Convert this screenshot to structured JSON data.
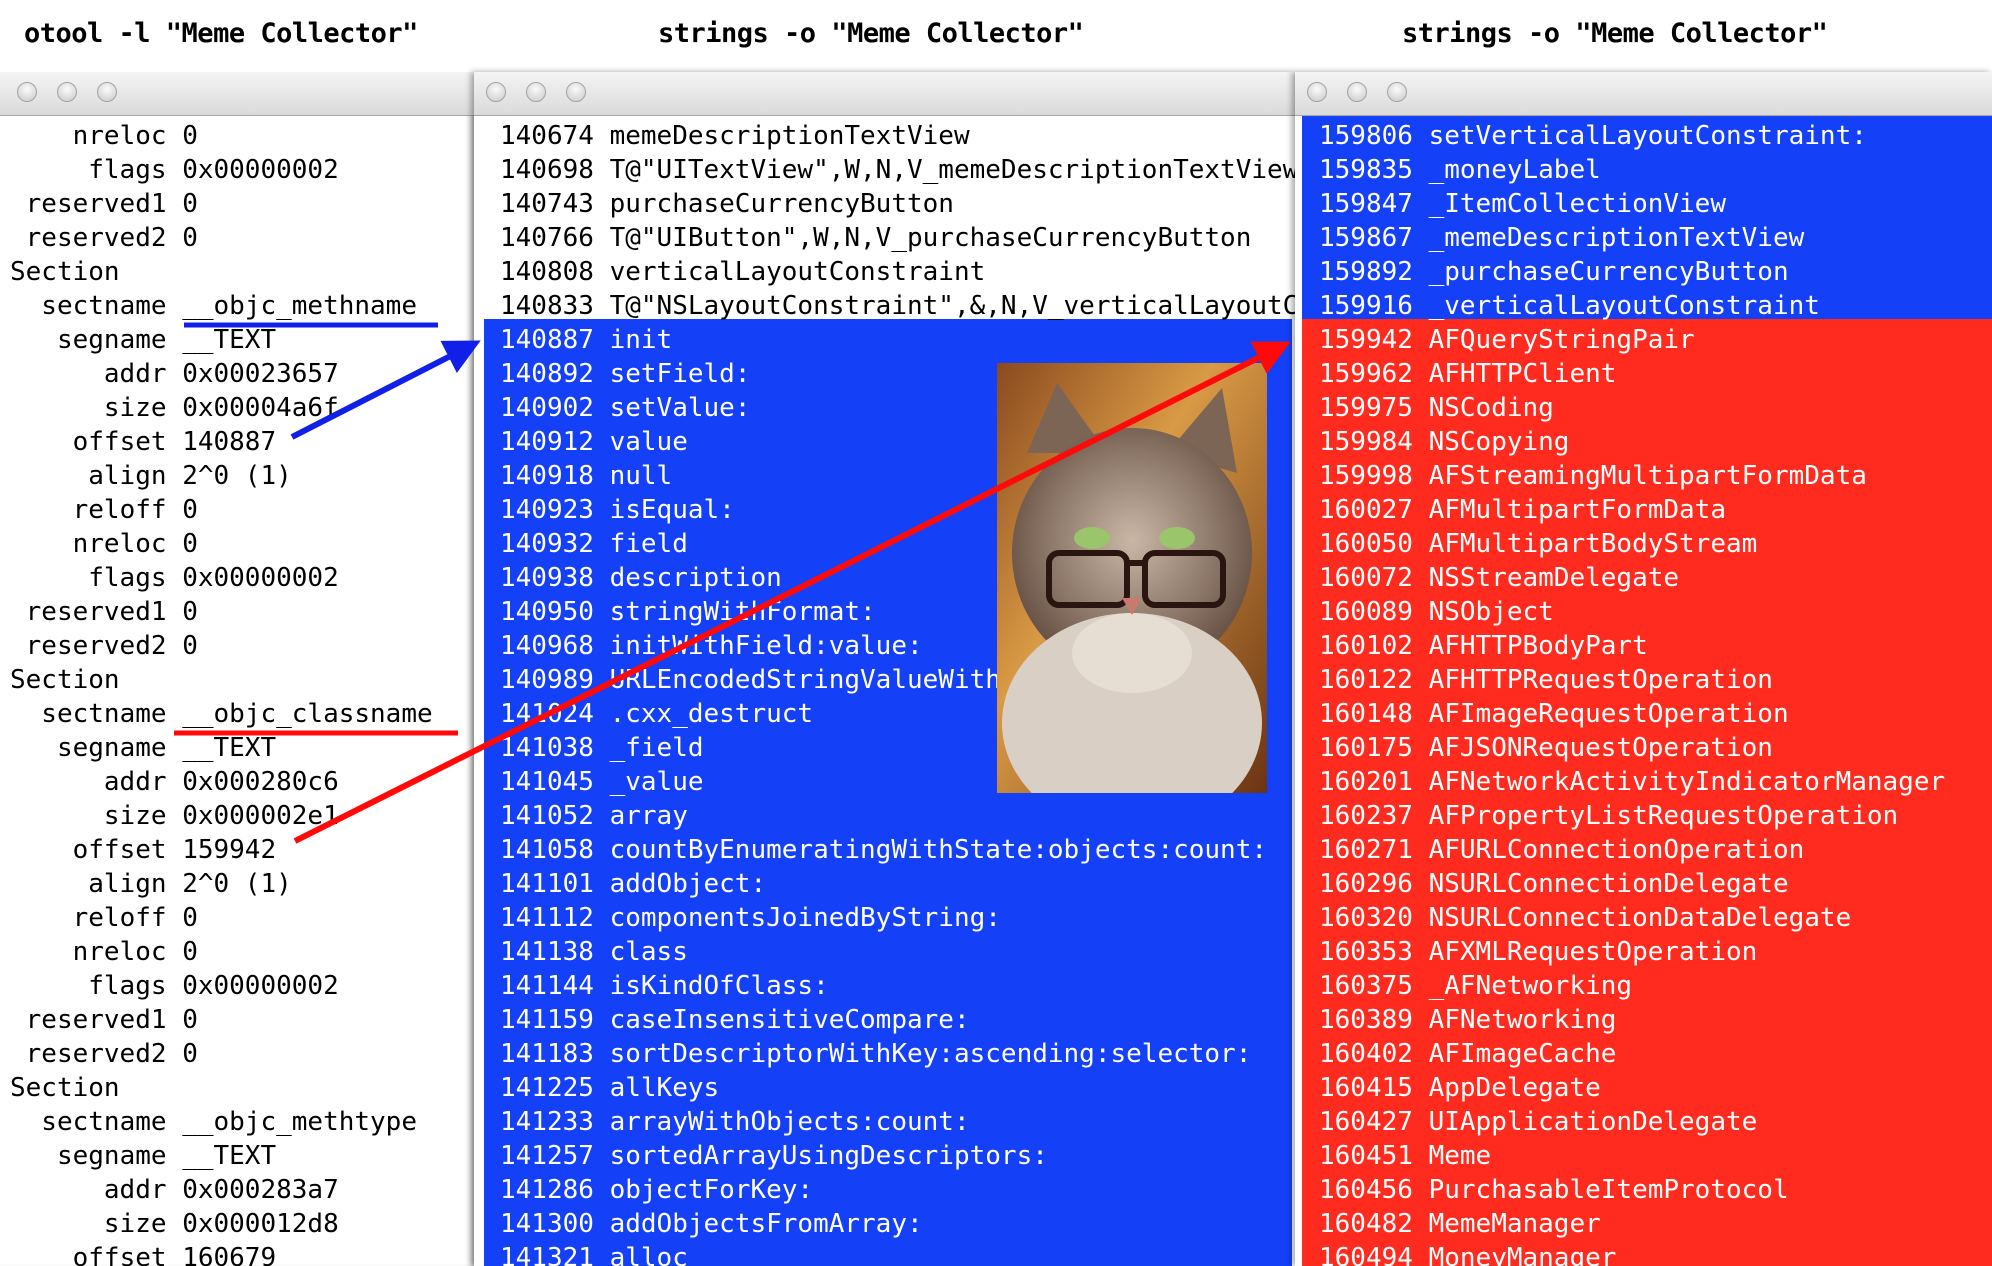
{
  "titles": {
    "left": "otool -l \"Meme Collector\"",
    "middle": "strings -o \"Meme Collector\"",
    "right": "strings -o \"Meme Collector\""
  },
  "colors": {
    "highlight_blue": "#1440f8",
    "highlight_red": "#ff2b1f"
  },
  "left": {
    "rows": [
      {
        "label": "nreloc",
        "value": "0"
      },
      {
        "label": "flags",
        "value": "0x00000002"
      },
      {
        "label": "reserved1",
        "value": "0"
      },
      {
        "label": "reserved2",
        "value": "0"
      },
      {
        "label": "Section"
      },
      {
        "label": "sectname",
        "value": "__objc_methname"
      },
      {
        "label": "segname",
        "value": "__TEXT"
      },
      {
        "label": "addr",
        "value": "0x00023657"
      },
      {
        "label": "size",
        "value": "0x00004a6f"
      },
      {
        "label": "offset",
        "value": "140887"
      },
      {
        "label": "align",
        "value": "2^0 (1)"
      },
      {
        "label": "reloff",
        "value": "0"
      },
      {
        "label": "nreloc",
        "value": "0"
      },
      {
        "label": "flags",
        "value": "0x00000002"
      },
      {
        "label": "reserved1",
        "value": "0"
      },
      {
        "label": "reserved2",
        "value": "0"
      },
      {
        "label": "Section"
      },
      {
        "label": "sectname",
        "value": "__objc_classname"
      },
      {
        "label": "segname",
        "value": "__TEXT"
      },
      {
        "label": "addr",
        "value": "0x000280c6"
      },
      {
        "label": "size",
        "value": "0x000002e1"
      },
      {
        "label": "offset",
        "value": "159942"
      },
      {
        "label": "align",
        "value": "2^0 (1)"
      },
      {
        "label": "reloff",
        "value": "0"
      },
      {
        "label": "nreloc",
        "value": "0"
      },
      {
        "label": "flags",
        "value": "0x00000002"
      },
      {
        "label": "reserved1",
        "value": "0"
      },
      {
        "label": "reserved2",
        "value": "0"
      },
      {
        "label": "Section"
      },
      {
        "label": "sectname",
        "value": "__objc_methtype"
      },
      {
        "label": "segname",
        "value": "__TEXT"
      },
      {
        "label": "addr",
        "value": "0x000283a7"
      },
      {
        "label": "size",
        "value": "0x000012d8"
      },
      {
        "label": "offset",
        "value": "160679"
      }
    ]
  },
  "middle": {
    "highlight_from_offset": "140887",
    "rows": [
      {
        "offset": "140674",
        "name": "memeDescriptionTextView"
      },
      {
        "offset": "140698",
        "name": "T@\"UITextView\",W,N,V_memeDescriptionTextView"
      },
      {
        "offset": "140743",
        "name": "purchaseCurrencyButton"
      },
      {
        "offset": "140766",
        "name": "T@\"UIButton\",W,N,V_purchaseCurrencyButton"
      },
      {
        "offset": "140808",
        "name": "verticalLayoutConstraint"
      },
      {
        "offset": "140833",
        "name": "T@\"NSLayoutConstraint\",&,N,V_verticalLayoutConstraint"
      },
      {
        "offset": "140887",
        "name": "init"
      },
      {
        "offset": "140892",
        "name": "setField:"
      },
      {
        "offset": "140902",
        "name": "setValue:"
      },
      {
        "offset": "140912",
        "name": "value"
      },
      {
        "offset": "140918",
        "name": "null"
      },
      {
        "offset": "140923",
        "name": "isEqual:"
      },
      {
        "offset": "140932",
        "name": "field"
      },
      {
        "offset": "140938",
        "name": "description"
      },
      {
        "offset": "140950",
        "name": "stringWithFormat:"
      },
      {
        "offset": "140968",
        "name": "initWithField:value:"
      },
      {
        "offset": "140989",
        "name": "URLEncodedStringValueWithEncoding:"
      },
      {
        "offset": "141024",
        "name": ".cxx_destruct"
      },
      {
        "offset": "141038",
        "name": "_field"
      },
      {
        "offset": "141045",
        "name": "_value"
      },
      {
        "offset": "141052",
        "name": "array"
      },
      {
        "offset": "141058",
        "name": "countByEnumeratingWithState:objects:count:"
      },
      {
        "offset": "141101",
        "name": "addObject:"
      },
      {
        "offset": "141112",
        "name": "componentsJoinedByString:"
      },
      {
        "offset": "141138",
        "name": "class"
      },
      {
        "offset": "141144",
        "name": "isKindOfClass:"
      },
      {
        "offset": "141159",
        "name": "caseInsensitiveCompare:"
      },
      {
        "offset": "141183",
        "name": "sortDescriptorWithKey:ascending:selector:"
      },
      {
        "offset": "141225",
        "name": "allKeys"
      },
      {
        "offset": "141233",
        "name": "arrayWithObjects:count:"
      },
      {
        "offset": "141257",
        "name": "sortedArrayUsingDescriptors:"
      },
      {
        "offset": "141286",
        "name": "objectForKey:"
      },
      {
        "offset": "141300",
        "name": "addObjectsFromArray:"
      },
      {
        "offset": "141321",
        "name": "alloc"
      }
    ]
  },
  "right": {
    "red_from_offset": "159942",
    "rows": [
      {
        "offset": "159806",
        "name": "setVerticalLayoutConstraint:"
      },
      {
        "offset": "159835",
        "name": "_moneyLabel"
      },
      {
        "offset": "159847",
        "name": "_ItemCollectionView"
      },
      {
        "offset": "159867",
        "name": "_memeDescriptionTextView"
      },
      {
        "offset": "159892",
        "name": "_purchaseCurrencyButton"
      },
      {
        "offset": "159916",
        "name": "_verticalLayoutConstraint"
      },
      {
        "offset": "159942",
        "name": "AFQueryStringPair"
      },
      {
        "offset": "159962",
        "name": "AFHTTPClient"
      },
      {
        "offset": "159975",
        "name": "NSCoding"
      },
      {
        "offset": "159984",
        "name": "NSCopying"
      },
      {
        "offset": "159998",
        "name": "AFStreamingMultipartFormData"
      },
      {
        "offset": "160027",
        "name": "AFMultipartFormData"
      },
      {
        "offset": "160050",
        "name": "AFMultipartBodyStream"
      },
      {
        "offset": "160072",
        "name": "NSStreamDelegate"
      },
      {
        "offset": "160089",
        "name": "NSObject"
      },
      {
        "offset": "160102",
        "name": "AFHTTPBodyPart"
      },
      {
        "offset": "160122",
        "name": "AFHTTPRequestOperation"
      },
      {
        "offset": "160148",
        "name": "AFImageRequestOperation"
      },
      {
        "offset": "160175",
        "name": "AFJSONRequestOperation"
      },
      {
        "offset": "160201",
        "name": "AFNetworkActivityIndicatorManager"
      },
      {
        "offset": "160237",
        "name": "AFPropertyListRequestOperation"
      },
      {
        "offset": "160271",
        "name": "AFURLConnectionOperation"
      },
      {
        "offset": "160296",
        "name": "NSURLConnectionDelegate"
      },
      {
        "offset": "160320",
        "name": "NSURLConnectionDataDelegate"
      },
      {
        "offset": "160353",
        "name": "AFXMLRequestOperation"
      },
      {
        "offset": "160375",
        "name": "_AFNetworking"
      },
      {
        "offset": "160389",
        "name": "AFNetworking"
      },
      {
        "offset": "160402",
        "name": "AFImageCache"
      },
      {
        "offset": "160415",
        "name": "AppDelegate"
      },
      {
        "offset": "160427",
        "name": "UIApplicationDelegate"
      },
      {
        "offset": "160451",
        "name": "Meme"
      },
      {
        "offset": "160456",
        "name": "PurchasableItemProtocol"
      },
      {
        "offset": "160482",
        "name": "MemeManager"
      },
      {
        "offset": "160494",
        "name": "MoneyManager"
      }
    ]
  },
  "image": {
    "subject": "cat-with-glasses"
  },
  "annotations": {
    "blue_arrow": "sectname __objc_methname offset -> strings 140887",
    "red_arrow": "sectname __objc_classname offset -> strings 159942"
  }
}
